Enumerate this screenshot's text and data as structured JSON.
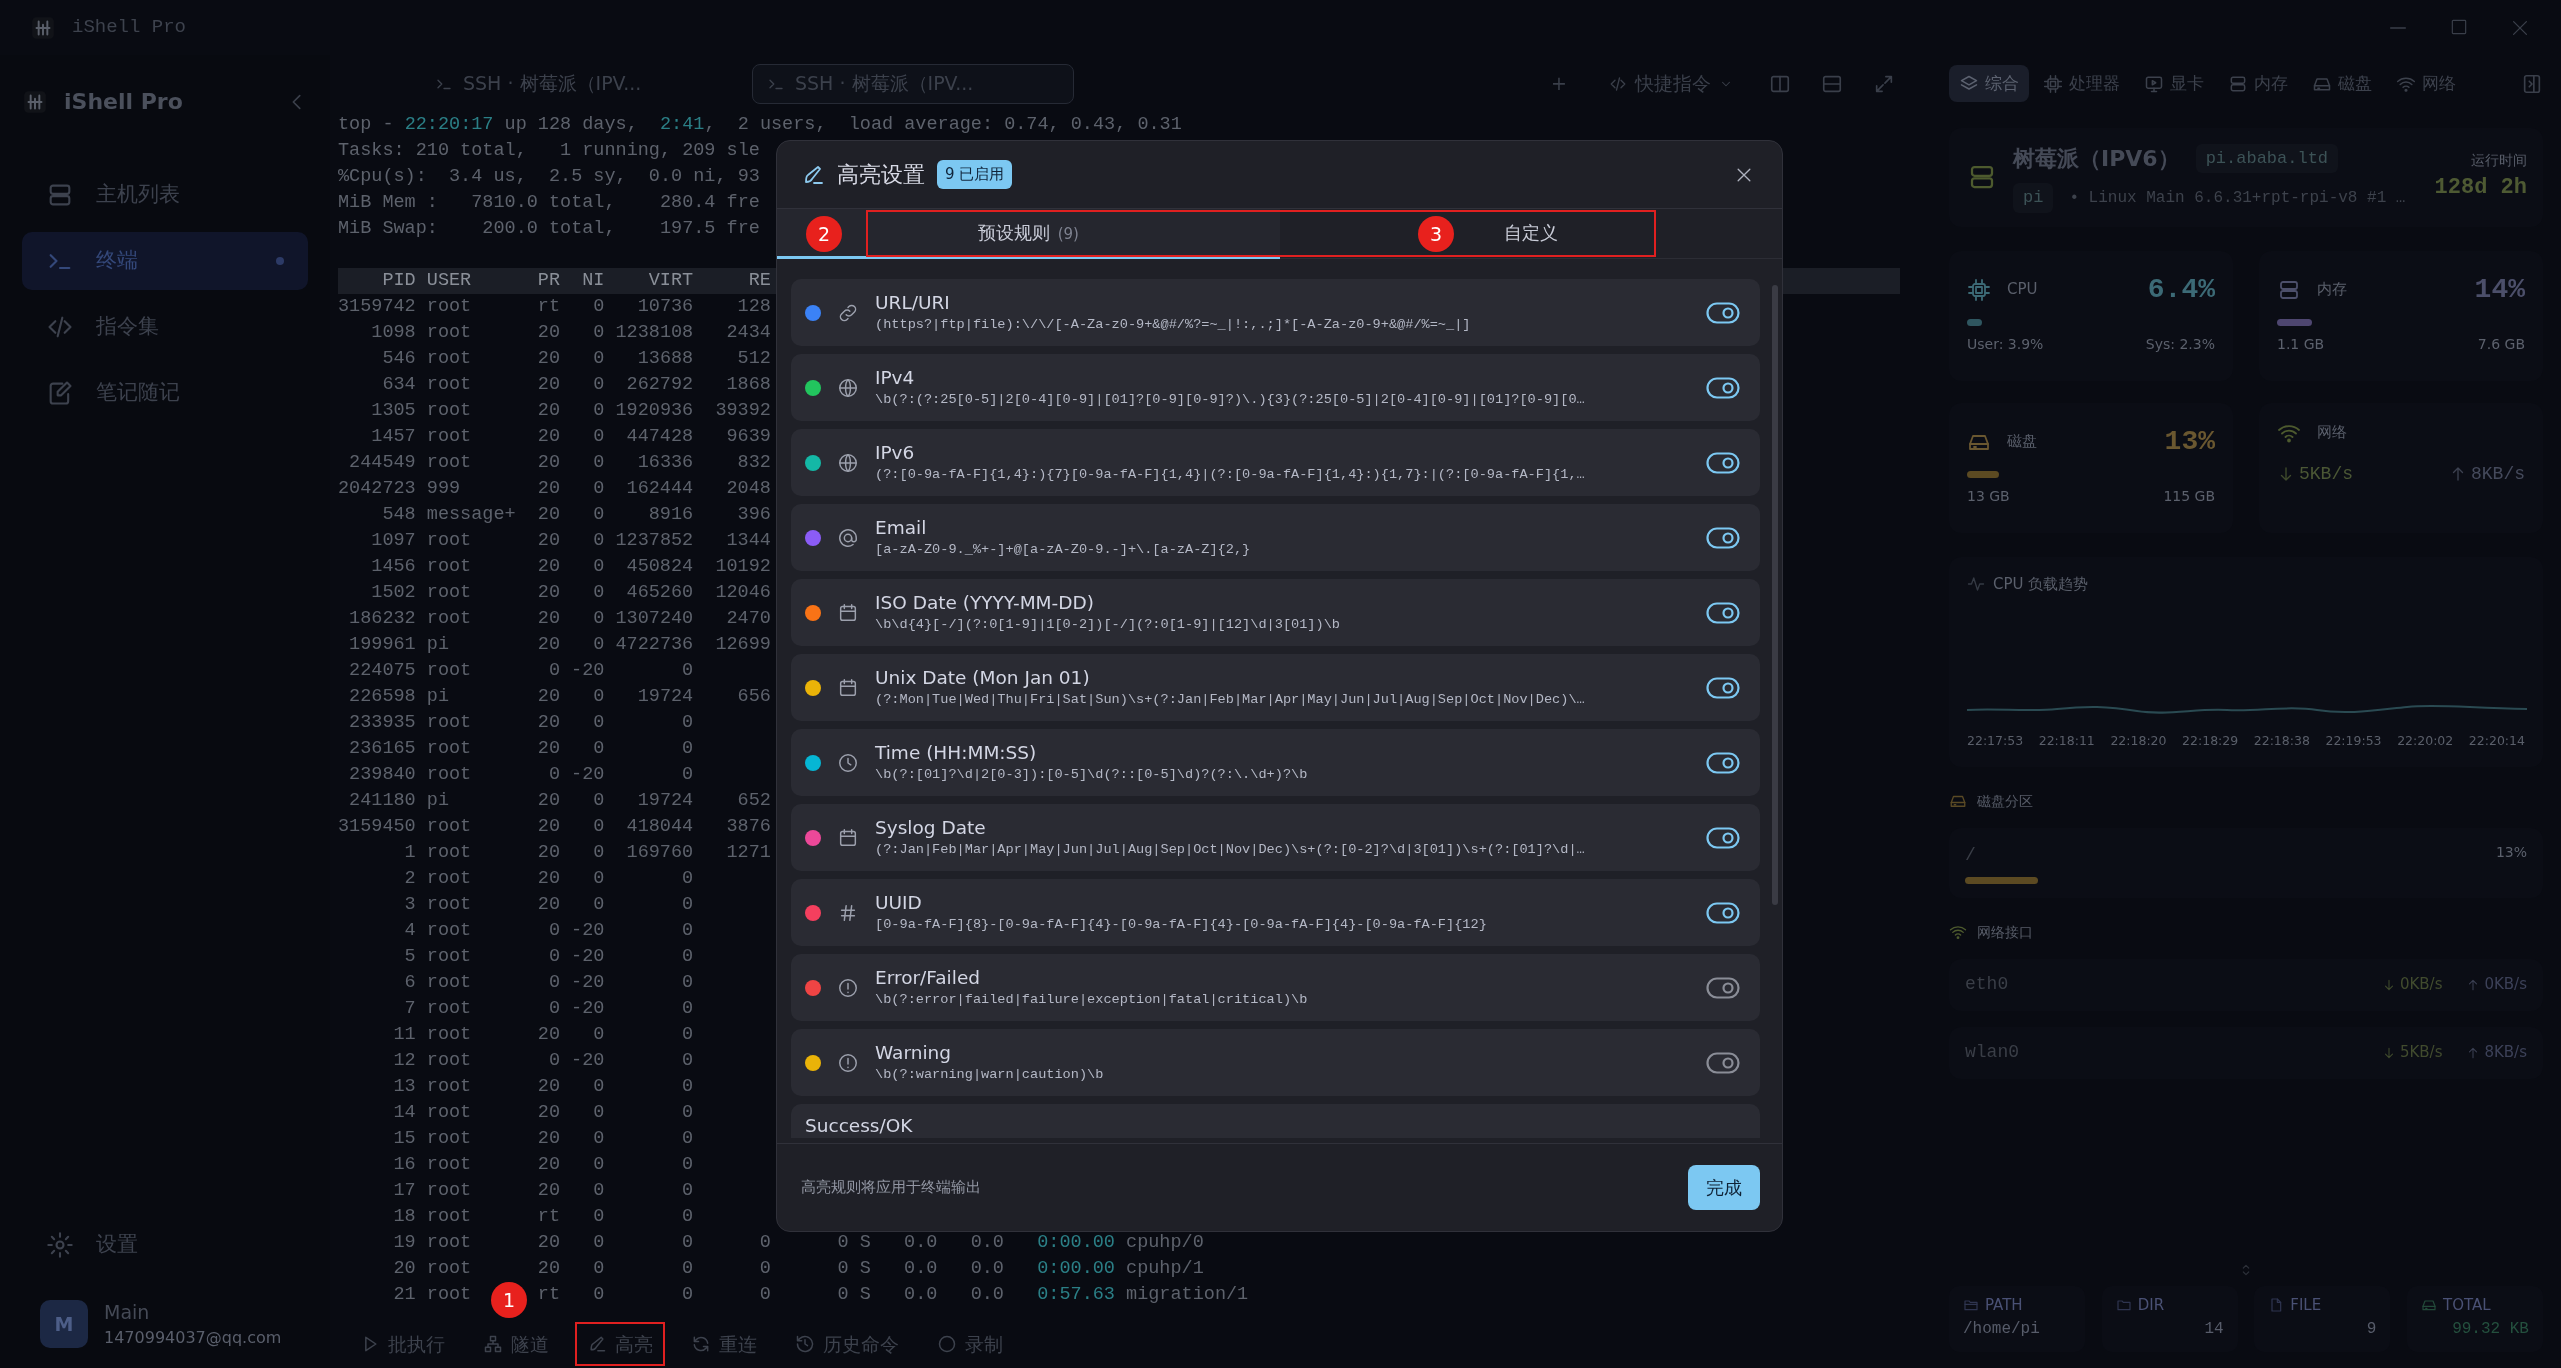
{
  "app_title": "iShell Pro",
  "sidebar": {
    "brand": "iShell Pro",
    "items": [
      {
        "label": "主机列表",
        "kind": "hosts",
        "selected": false
      },
      {
        "label": "终端",
        "kind": "terminal",
        "selected": true
      },
      {
        "label": "指令集",
        "kind": "snippets",
        "selected": false
      },
      {
        "label": "笔记随记",
        "kind": "notes",
        "selected": false
      }
    ],
    "settings": "设置",
    "user": {
      "avatar": "M",
      "name": "Main",
      "email": "1470994037@qq.com"
    }
  },
  "terminal": {
    "tabs": [
      {
        "label": "SSH · 树莓派（IPV...",
        "selected": false
      },
      {
        "label": "SSH · 树莓派（IPV...",
        "selected": true
      }
    ],
    "new_tab": "+",
    "snippets": "快捷指令",
    "summary": [
      {
        "parts": [
          {
            "text": "top - ",
            "highlight": false
          },
          {
            "text": "22:20:17",
            "highlight": true
          },
          {
            "text": " up 128 days,  ",
            "highlight": false
          },
          {
            "text": "2:41",
            "highlight": true
          },
          {
            "text": ",  2 users,  load average: 0.74, 0.43, 0.31",
            "highlight": false
          }
        ]
      },
      {
        "parts": [
          {
            "text": "Tasks: 210 total,   1 running, 209 sle",
            "highlight": false
          }
        ]
      },
      {
        "parts": [
          {
            "text": "%Cpu(s):  3.4 us,  2.5 sy,  0.0 ni, 93",
            "highlight": false
          }
        ]
      },
      {
        "parts": [
          {
            "text": "MiB Mem :   7810.0 total,    280.4 fre",
            "highlight": false
          }
        ]
      },
      {
        "parts": [
          {
            "text": "MiB Swap:    200.0 total,    197.5 fre",
            "highlight": false
          }
        ]
      }
    ],
    "columns": [
      "PID",
      "USER",
      "PR",
      "NI",
      "VIRT",
      "RE"
    ],
    "rows": [
      [
        "3159742",
        "root",
        "rt",
        "0",
        "10736",
        "128"
      ],
      [
        "1098",
        "root",
        "20",
        "0",
        "1238108",
        "2434"
      ],
      [
        "546",
        "root",
        "20",
        "0",
        "13688",
        "512"
      ],
      [
        "634",
        "root",
        "20",
        "0",
        "262792",
        "1868"
      ],
      [
        "1305",
        "root",
        "20",
        "0",
        "1920936",
        "39392"
      ],
      [
        "1457",
        "root",
        "20",
        "0",
        "447428",
        "9639"
      ],
      [
        "244549",
        "root",
        "20",
        "0",
        "16336",
        "832"
      ],
      [
        "2042723",
        "999",
        "20",
        "0",
        "162444",
        "2048"
      ],
      [
        "548",
        "message+",
        "20",
        "0",
        "8916",
        "396"
      ],
      [
        "1097",
        "root",
        "20",
        "0",
        "1237852",
        "1344"
      ],
      [
        "1456",
        "root",
        "20",
        "0",
        "450824",
        "10192"
      ],
      [
        "1502",
        "root",
        "20",
        "0",
        "465260",
        "12046"
      ],
      [
        "186232",
        "root",
        "20",
        "0",
        "1307240",
        "2470"
      ],
      [
        "199961",
        "pi",
        "20",
        "0",
        "4722736",
        "12699"
      ],
      [
        "224075",
        "root",
        "0",
        "-20",
        "0"
      ],
      [
        "226598",
        "pi",
        "20",
        "0",
        "19724",
        "656"
      ],
      [
        "233935",
        "root",
        "20",
        "0",
        "0"
      ],
      [
        "236165",
        "root",
        "20",
        "0",
        "0"
      ],
      [
        "239840",
        "root",
        "0",
        "-20",
        "0"
      ],
      [
        "241180",
        "pi",
        "20",
        "0",
        "19724",
        "652"
      ],
      [
        "3159450",
        "root",
        "20",
        "0",
        "418044",
        "3876"
      ],
      [
        "1",
        "root",
        "20",
        "0",
        "169760",
        "1271"
      ],
      [
        "2",
        "root",
        "20",
        "0",
        "0"
      ],
      [
        "3",
        "root",
        "20",
        "0",
        "0"
      ],
      [
        "4",
        "root",
        "0",
        "-20",
        "0"
      ],
      [
        "5",
        "root",
        "0",
        "-20",
        "0"
      ],
      [
        "6",
        "root",
        "0",
        "-20",
        "0"
      ],
      [
        "7",
        "root",
        "0",
        "-20",
        "0"
      ],
      [
        "11",
        "root",
        "20",
        "0",
        "0"
      ],
      [
        "12",
        "root",
        "0",
        "-20",
        "0"
      ],
      [
        "13",
        "root",
        "20",
        "0",
        "0"
      ],
      [
        "14",
        "root",
        "20",
        "0",
        "0"
      ],
      [
        "15",
        "root",
        "20",
        "0",
        "0"
      ],
      [
        "16",
        "root",
        "20",
        "0",
        "0"
      ],
      [
        "17",
        "root",
        "20",
        "0",
        "0"
      ],
      [
        "18",
        "root",
        "rt",
        "0",
        "0"
      ],
      [
        "19",
        "root",
        "20",
        "0",
        "0",
        "0",
        "0",
        "S",
        "0.0",
        "0.0",
        "0:00.00",
        "cpuhp/0"
      ],
      [
        "20",
        "root",
        "20",
        "0",
        "0",
        "0",
        "0",
        "S",
        "0.0",
        "0.0",
        "0:00.00",
        "cpuhp/1"
      ],
      [
        "21",
        "root",
        "rt",
        "0",
        "0",
        "0",
        "0",
        "S",
        "0.0",
        "0.0",
        "0:57.63",
        "migration/1"
      ]
    ],
    "tools": [
      {
        "label": "批执行",
        "kind": "batch"
      },
      {
        "label": "隧道",
        "kind": "tunnel"
      },
      {
        "label": "高亮",
        "kind": "highlight",
        "annotation": "1",
        "outlined": true
      },
      {
        "label": "重连",
        "kind": "reconnect"
      },
      {
        "label": "历史命令",
        "kind": "history"
      },
      {
        "label": "录制",
        "kind": "record"
      }
    ]
  },
  "monitor": {
    "tabs": [
      {
        "label": "综合",
        "kind": "overview",
        "selected": true
      },
      {
        "label": "处理器",
        "kind": "cpu",
        "selected": false
      },
      {
        "label": "显卡",
        "kind": "gpu",
        "selected": false
      },
      {
        "label": "内存",
        "kind": "memory",
        "selected": false
      },
      {
        "label": "磁盘",
        "kind": "disk",
        "selected": false
      },
      {
        "label": "网络",
        "kind": "network",
        "selected": false
      }
    ],
    "host": {
      "name": "树莓派（IPV6）",
      "address": "pi.ababa.ltd",
      "user": "pi",
      "system": "• Linux Main 6.6.31+rpt-rpi-v8 #1 …",
      "uptime_label": "运行时间",
      "uptime": "128d 2h"
    },
    "stats": [
      {
        "kind": "cpu",
        "label": "CPU",
        "value": "6.4%",
        "level": 0.06,
        "left": "User: 3.9%",
        "right": "Sys: 2.3%"
      },
      {
        "kind": "memory",
        "label": "内存",
        "value": "14%",
        "level": 0.14,
        "left": "1.1 GB",
        "right": "7.6 GB"
      },
      {
        "kind": "disk",
        "label": "磁盘",
        "value": "13%",
        "level": 0.13,
        "left": "13 GB",
        "right": "115 GB"
      },
      {
        "kind": "network",
        "label": "网络",
        "down": "5KB/s",
        "up": "8KB/s"
      }
    ],
    "chart": {
      "title": "CPU 负载趋势",
      "time_labels": [
        "22:17:53",
        "22:18:11",
        "22:18:20",
        "22:18:29",
        "22:18:38",
        "22:19:53",
        "22:20:02",
        "22:20:14"
      ]
    },
    "partitions": {
      "title": "磁盘分区",
      "items": [
        {
          "mount": "/",
          "value": "13%",
          "level": 0.13
        }
      ]
    },
    "interfaces": {
      "title": "网络接口",
      "items": [
        {
          "name": "eth0",
          "down": "0KB/s",
          "up": "0KB/s"
        },
        {
          "name": "wlan0",
          "down": "5KB/s",
          "up": "8KB/s"
        }
      ]
    },
    "files": [
      {
        "kind": "path",
        "label": "PATH",
        "value": "/home/pi"
      },
      {
        "kind": "dir",
        "label": "DIR",
        "value": "14"
      },
      {
        "kind": "file",
        "label": "FILE",
        "value": "9"
      },
      {
        "kind": "total",
        "label": "TOTAL",
        "value": "99.32 KB"
      }
    ]
  },
  "dialog": {
    "title": "高亮设置",
    "badge": "9 已启用",
    "tabs": [
      {
        "label": "预设规则",
        "count": "(9)",
        "selected": true,
        "annotation": "2"
      },
      {
        "label": "自定义",
        "selected": false,
        "annotation": "3"
      }
    ],
    "tabs_outlined": true,
    "rules": [
      {
        "name": "URL/URI",
        "kind": "url",
        "color": "#3b82f6",
        "pattern": "(https?|ftp|file):\\/\\/[-A-Za-z0-9+&@#/%?=~_|!:,.;]*[-A-Za-z0-9+&@#/%=~_|]",
        "enabled": true
      },
      {
        "name": "IPv4",
        "kind": "network",
        "color": "#22c55e",
        "pattern": "\\b(?:(?:25[0-5]|2[0-4][0-9]|[01]?[0-9][0-9]?)\\.){3}(?:25[0-5]|2[0-4][0-9]|[01]?[0-9][0…",
        "enabled": true
      },
      {
        "name": "IPv6",
        "kind": "network",
        "color": "#14b8a6",
        "pattern": "(?:[0-9a-fA-F]{1,4}:){7}[0-9a-fA-F]{1,4}|(?:[0-9a-fA-F]{1,4}:){1,7}:|(?:[0-9a-fA-F]{1,…",
        "enabled": true
      },
      {
        "name": "Email",
        "kind": "email",
        "color": "#8b5cf6",
        "pattern": "[a-zA-Z0-9._%+-]+@[a-zA-Z0-9.-]+\\.[a-zA-Z]{2,}",
        "enabled": true
      },
      {
        "name": "ISO Date (YYYY-MM-DD)",
        "kind": "date",
        "color": "#f97316",
        "pattern": "\\b\\d{4}[-/](?:0[1-9]|1[0-2])[-/](?:0[1-9]|[12]\\d|3[01])\\b",
        "enabled": true
      },
      {
        "name": "Unix Date (Mon Jan 01)",
        "kind": "date",
        "color": "#eab308",
        "pattern": "(?:Mon|Tue|Wed|Thu|Fri|Sat|Sun)\\s+(?:Jan|Feb|Mar|Apr|May|Jun|Jul|Aug|Sep|Oct|Nov|Dec)\\…",
        "enabled": true
      },
      {
        "name": "Time (HH:MM:SS)",
        "kind": "time",
        "color": "#06b6d4",
        "pattern": "\\b(?:[01]?\\d|2[0-3]):[0-5]\\d(?::[0-5]\\d)?(?:\\.\\d+)?\\b",
        "enabled": true
      },
      {
        "name": "Syslog Date",
        "kind": "date",
        "color": "#ec4899",
        "pattern": "(?:Jan|Feb|Mar|Apr|May|Jun|Jul|Aug|Sep|Oct|Nov|Dec)\\s+(?:[0-2]?\\d|3[01])\\s+(?:[01]?\\d|…",
        "enabled": true
      },
      {
        "name": "UUID",
        "kind": "id",
        "color": "#f43f5e",
        "pattern": "[0-9a-fA-F]{8}-[0-9a-fA-F]{4}-[0-9a-fA-F]{4}-[0-9a-fA-F]{4}-[0-9a-fA-F]{12}",
        "enabled": true
      },
      {
        "name": "Error/Failed",
        "kind": "alert",
        "color": "#ef4444",
        "pattern": "\\b(?:error|failed|failure|exception|fatal|critical)\\b",
        "enabled": false
      },
      {
        "name": "Warning",
        "kind": "alert",
        "color": "#eab308",
        "pattern": "\\b(?:warning|warn|caution)\\b",
        "enabled": false
      },
      {
        "name": "Success/OK"
      }
    ],
    "footer_note": "高亮规则将应用于终端输出",
    "done": "完成"
  }
}
